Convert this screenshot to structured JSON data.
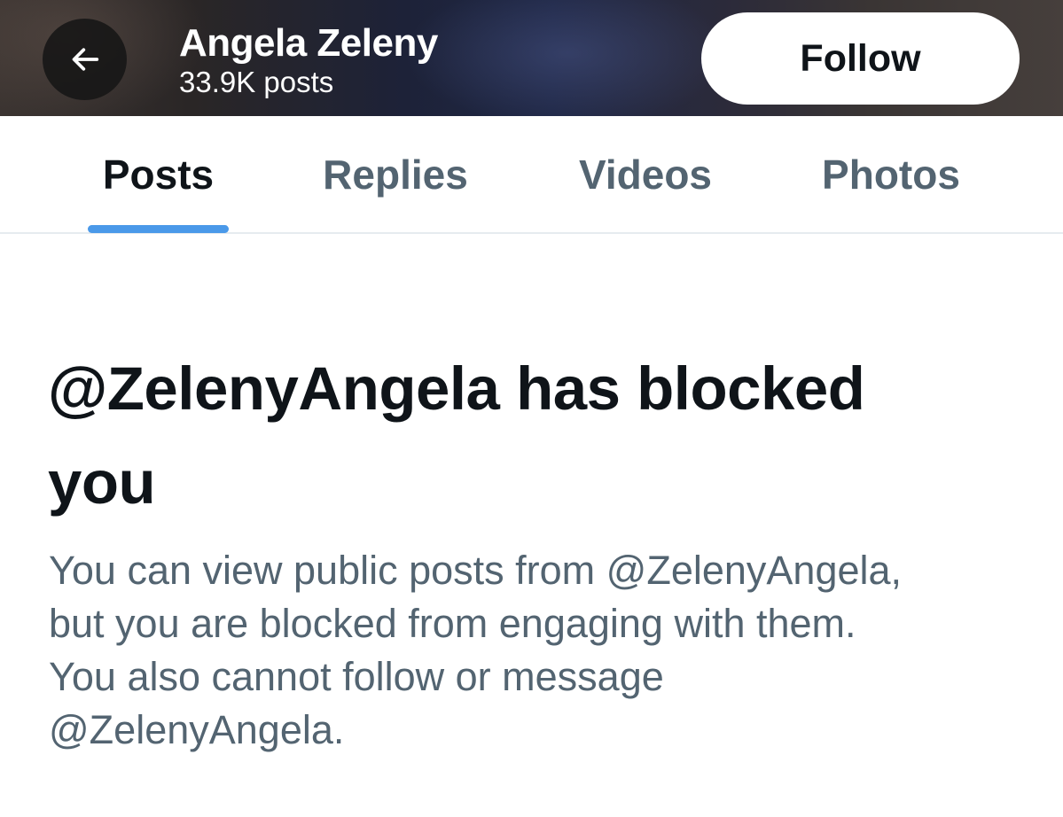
{
  "header": {
    "back_icon": "arrow-left-icon",
    "name": "Angela Zeleny",
    "post_count": "33.9K posts",
    "follow_label": "Follow"
  },
  "tabs": [
    {
      "label": "Posts",
      "active": true
    },
    {
      "label": "Replies",
      "active": false
    },
    {
      "label": "Videos",
      "active": false
    },
    {
      "label": "Photos",
      "active": false
    }
  ],
  "blocked": {
    "line1": "@ZelenyAngela has blocked",
    "line2": "you",
    "desc_line1": "You can view public posts from @ZelenyAngela,",
    "desc_line2": "but you are blocked from engaging with them.",
    "desc_line3": "You also cannot follow or message",
    "desc_line4": "@ZelenyAngela."
  },
  "colors": {
    "accent": "#4a99e9",
    "primary_text": "#0f1419",
    "secondary_text": "#536471"
  }
}
